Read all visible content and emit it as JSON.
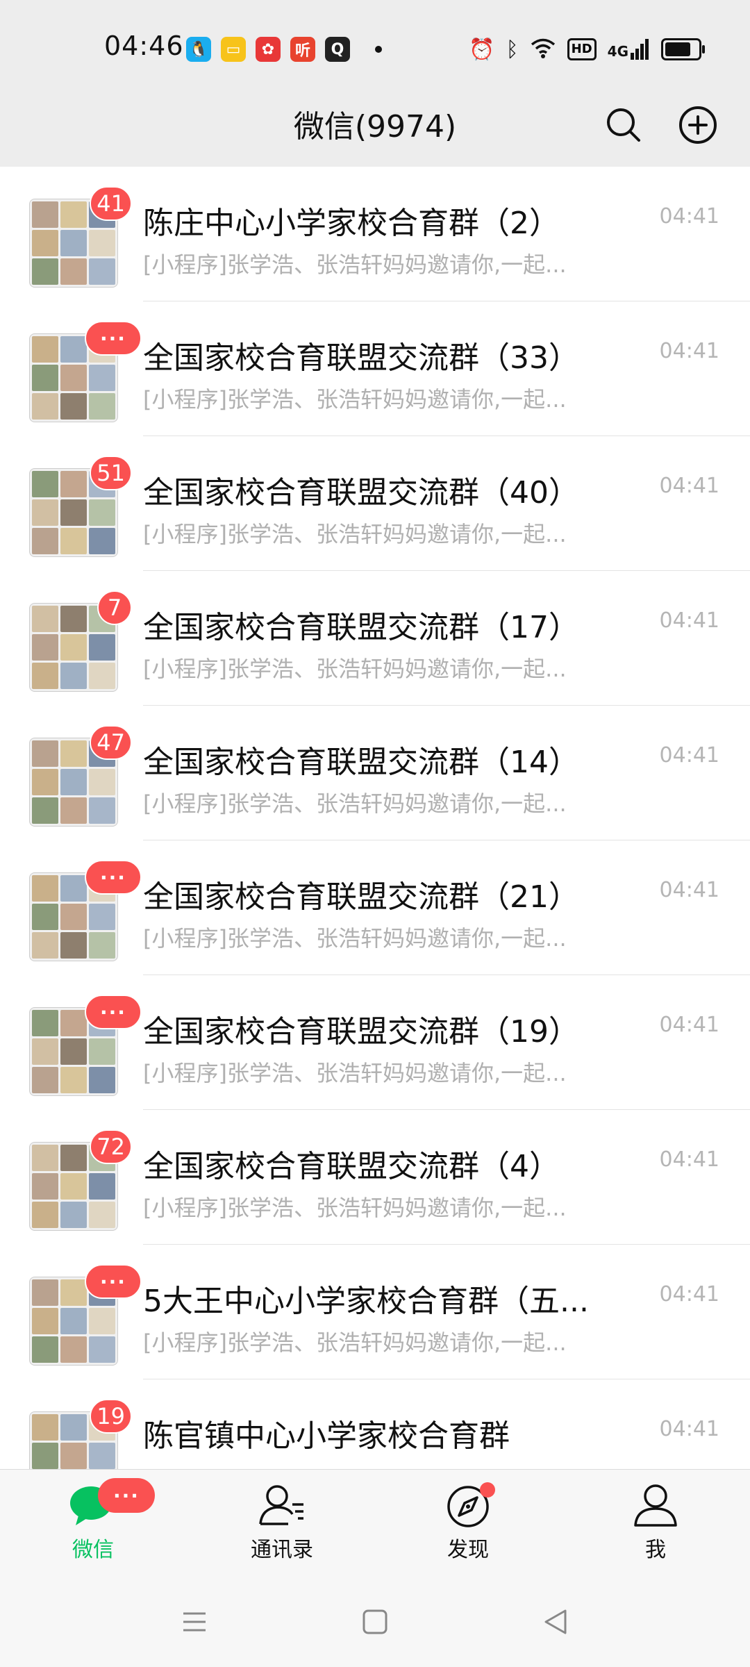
{
  "status_bar": {
    "time": "04:46",
    "notification_icons": [
      {
        "name": "qq-icon",
        "color": "#1aadef",
        "glyph": "🐧"
      },
      {
        "name": "notes-icon",
        "color": "#f7c31a",
        "glyph": "▭"
      },
      {
        "name": "app-icon",
        "color": "#e83838",
        "glyph": "✿"
      },
      {
        "name": "listen-icon",
        "color": "#e8432e",
        "glyph": "听"
      },
      {
        "name": "q-icon",
        "color": "#222222",
        "glyph": "Q"
      }
    ],
    "system_icons": [
      "alarm-icon",
      "bluetooth-icon",
      "wifi-icon",
      "hd-icon",
      "signal-4g-icon",
      "battery-icon"
    ],
    "hd_label": "HD",
    "signal_label": "4G"
  },
  "header": {
    "title": "微信(9974)",
    "search_icon": "search-icon",
    "add_icon": "plus-circle-icon"
  },
  "chats": [
    {
      "title": "陈庄中心小学家校合育群（2）",
      "preview": "[小程序]张学浩、张浩轩妈妈邀请你,一起...",
      "time": "04:41",
      "badge": "41"
    },
    {
      "title": "全国家校合育联盟交流群（33）",
      "preview": "[小程序]张学浩、张浩轩妈妈邀请你,一起...",
      "time": "04:41",
      "badge": "···"
    },
    {
      "title": "全国家校合育联盟交流群（40）",
      "preview": "[小程序]张学浩、张浩轩妈妈邀请你,一起...",
      "time": "04:41",
      "badge": "51"
    },
    {
      "title": "全国家校合育联盟交流群（17）",
      "preview": "[小程序]张学浩、张浩轩妈妈邀请你,一起...",
      "time": "04:41",
      "badge": "7"
    },
    {
      "title": "全国家校合育联盟交流群（14）",
      "preview": "[小程序]张学浩、张浩轩妈妈邀请你,一起...",
      "time": "04:41",
      "badge": "47"
    },
    {
      "title": "全国家校合育联盟交流群（21）",
      "preview": "[小程序]张学浩、张浩轩妈妈邀请你,一起...",
      "time": "04:41",
      "badge": "···"
    },
    {
      "title": "全国家校合育联盟交流群（19）",
      "preview": "[小程序]张学浩、张浩轩妈妈邀请你,一起...",
      "time": "04:41",
      "badge": "···"
    },
    {
      "title": "全国家校合育联盟交流群（4）",
      "preview": "[小程序]张学浩、张浩轩妈妈邀请你,一起...",
      "time": "04:41",
      "badge": "72"
    },
    {
      "title": "5大王中心小学家校合育群（五...",
      "preview": "[小程序]张学浩、张浩轩妈妈邀请你,一起...",
      "time": "04:41",
      "badge": "···"
    },
    {
      "title": "陈官镇中心小学家校合育群",
      "preview": "",
      "time": "04:41",
      "badge": "19"
    }
  ],
  "tabs": [
    {
      "label": "微信",
      "icon": "chat-bubble-icon",
      "active": true,
      "badge": "···"
    },
    {
      "label": "通讯录",
      "icon": "contacts-icon",
      "active": false
    },
    {
      "label": "发现",
      "icon": "compass-icon",
      "active": false,
      "dot": true
    },
    {
      "label": "我",
      "icon": "person-icon",
      "active": false
    }
  ],
  "system_nav": [
    "menu-icon",
    "home-icon",
    "back-icon"
  ],
  "colors": {
    "accent": "#07c160",
    "badge": "#fa5151",
    "background": "#ededed",
    "text_secondary": "#b0b0b0"
  }
}
